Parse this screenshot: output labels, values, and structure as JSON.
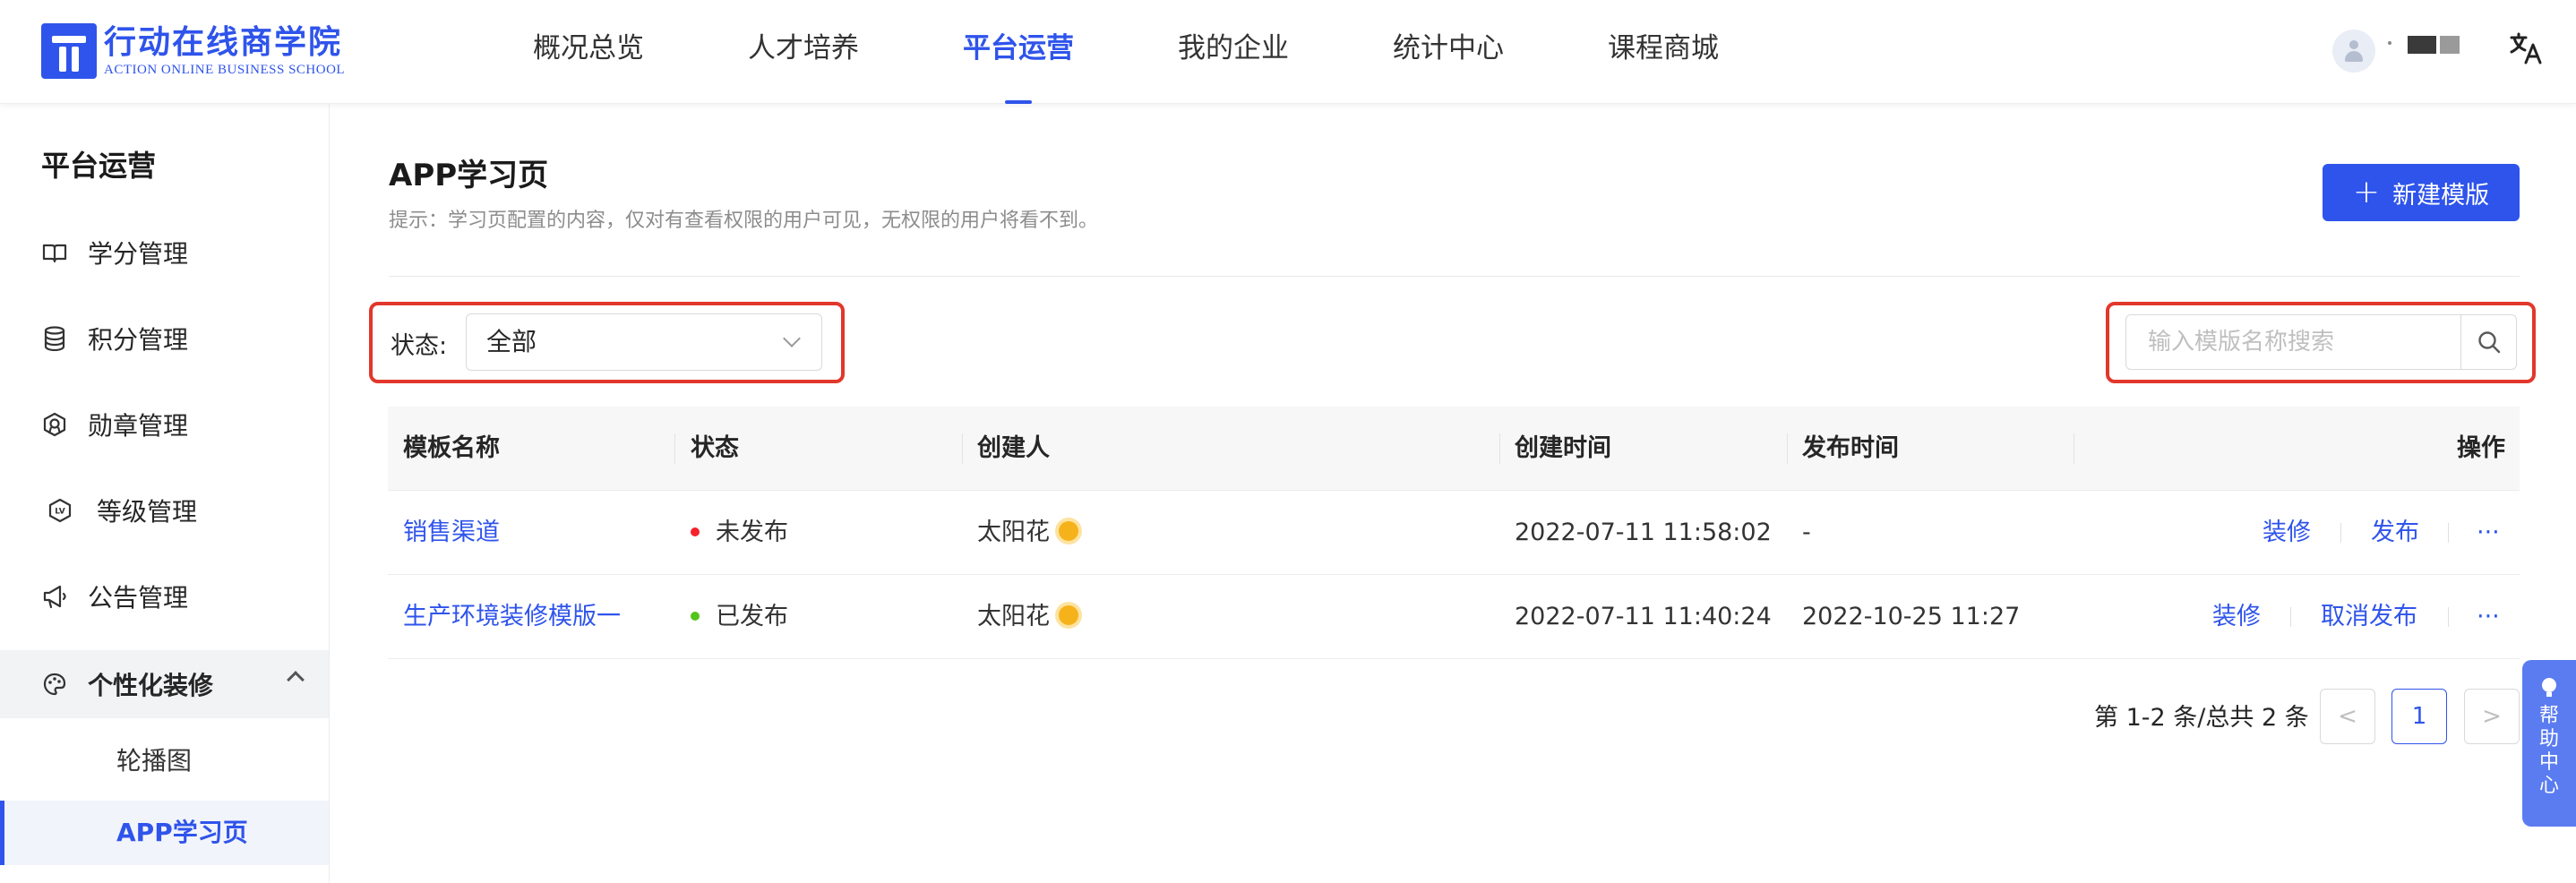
{
  "brand": {
    "name_cn": "行动在线商学院",
    "name_en": "ACTION ONLINE BUSINESS SCHOOL",
    "color": "#2f54eb"
  },
  "nav": {
    "items": [
      {
        "label": "概况总览",
        "active": false
      },
      {
        "label": "人才培养",
        "active": false
      },
      {
        "label": "平台运营",
        "active": true
      },
      {
        "label": "我的企业",
        "active": false
      },
      {
        "label": "统计中心",
        "active": false
      },
      {
        "label": "课程商城",
        "active": false
      }
    ],
    "translate_icon": "translate-icon",
    "avatar_icon": "user-avatar-icon"
  },
  "sidebar": {
    "title": "平台运营",
    "items": [
      {
        "label": "学分管理",
        "icon": "book-icon"
      },
      {
        "label": "积分管理",
        "icon": "database-icon"
      },
      {
        "label": "勋章管理",
        "icon": "medal-icon"
      },
      {
        "label": "等级管理",
        "icon": "level-icon"
      },
      {
        "label": "公告管理",
        "icon": "megaphone-icon"
      },
      {
        "label": "个性化装修",
        "icon": "palette-icon",
        "expanded": true
      }
    ],
    "subitems": [
      {
        "label": "轮播图",
        "active": false
      },
      {
        "label": "APP学习页",
        "active": true
      }
    ]
  },
  "main": {
    "title": "APP学习页",
    "tip": "提示：学习页配置的内容，仅对有查看权限的用户可见，无权限的用户将看不到。",
    "new_button": "新建模版",
    "filter": {
      "label": "状态:",
      "value": "全部"
    },
    "search": {
      "placeholder": "输入模版名称搜索",
      "value": ""
    },
    "table": {
      "columns": [
        "模板名称",
        "状态",
        "创建人",
        "创建时间",
        "发布时间",
        "操作"
      ],
      "rows": [
        {
          "name": "销售渠道",
          "status": "未发布",
          "status_color": "#f5222d",
          "creator": "太阳花",
          "created": "2022-07-11 11:58:02",
          "published": "-",
          "actions": [
            "装修",
            "发布",
            "···"
          ]
        },
        {
          "name": "生产环境装修模版一",
          "status": "已发布",
          "status_color": "#52c41a",
          "creator": "太阳花",
          "created": "2022-07-11 11:40:24",
          "published": "2022-10-25 11:27",
          "actions": [
            "装修",
            "取消发布",
            "···"
          ]
        }
      ]
    },
    "pagination": {
      "info": "第 1-2 条/总共 2 条",
      "prev": "<",
      "current": "1",
      "next": ">"
    }
  },
  "help": {
    "label": "帮助中心"
  }
}
